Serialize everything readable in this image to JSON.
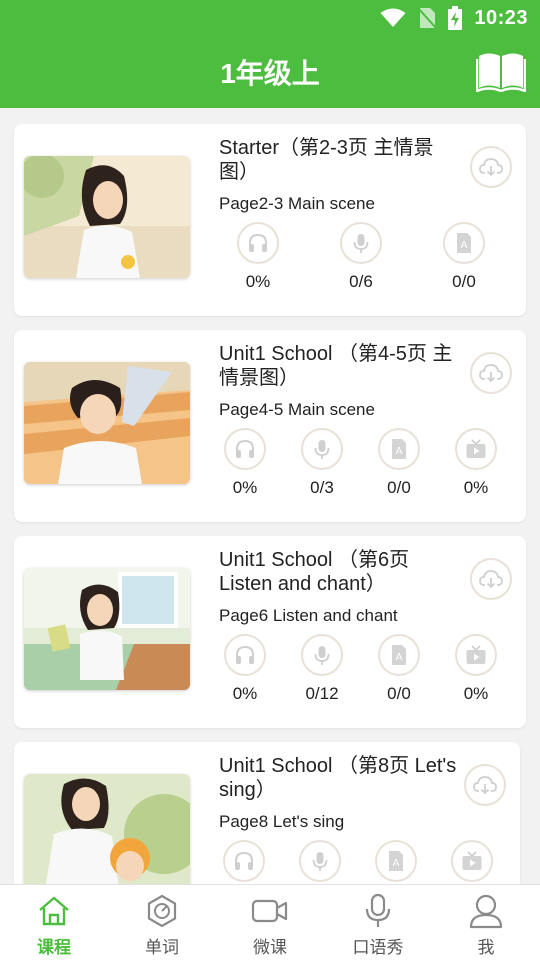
{
  "status_bar": {
    "time": "10:23"
  },
  "header": {
    "title": "1年级上"
  },
  "lessons": [
    {
      "title": "Starter（第2-3页 主情景图）",
      "subtitle": "Page2-3 Main scene",
      "stats": [
        "0%",
        "0/6",
        "0/0"
      ]
    },
    {
      "title": "Unit1 School （第4-5页 主情景图）",
      "subtitle": "Page4-5 Main scene",
      "stats": [
        "0%",
        "0/3",
        "0/0",
        "0%"
      ]
    },
    {
      "title": "Unit1 School （第6页 Listen and chant）",
      "subtitle": "Page6 Listen and chant",
      "stats": [
        "0%",
        "0/12",
        "0/0",
        "0%"
      ]
    },
    {
      "title": "Unit1 School （第8页 Let's sing）",
      "subtitle": "Page8 Let's sing",
      "stats": [
        "",
        "",
        "",
        ""
      ]
    }
  ],
  "tabs": [
    {
      "label": "课程",
      "icon": "home-icon",
      "active": true
    },
    {
      "label": "单词",
      "icon": "word-badge-icon",
      "active": false
    },
    {
      "label": "微课",
      "icon": "video-camera-icon",
      "active": false
    },
    {
      "label": "口语秀",
      "icon": "microphone-icon",
      "active": false
    },
    {
      "label": "我",
      "icon": "user-icon",
      "active": false
    }
  ],
  "colors": {
    "accent": "#4cbd3f",
    "icon_ring": "#e8e1d7",
    "icon_gray": "#cfcfcf"
  }
}
